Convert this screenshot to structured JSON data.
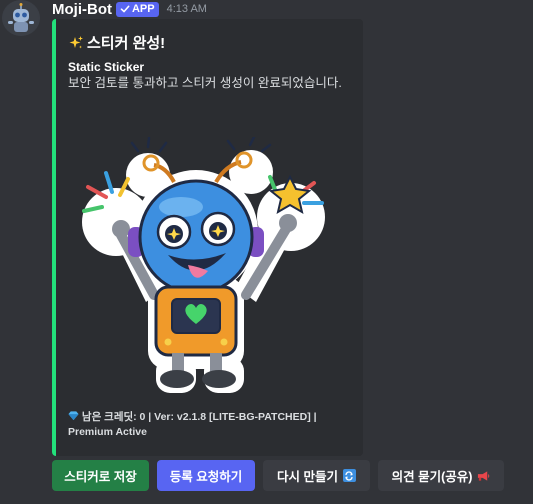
{
  "message": {
    "username": "Moji-Bot",
    "app_badge": "APP",
    "timestamp": "4:13 AM",
    "avatar_icon": "robot-avatar-icon",
    "embed": {
      "accent_color": "#23e07b",
      "title_emoji": "sparkles-icon",
      "title": "스티커 완성!",
      "field_name": "Static Sticker",
      "field_value": "보안 검토를 통과하고 스티커 생성이 완료되었습니다.",
      "image": "robot-sticker-image",
      "footer_emoji": "gem-icon",
      "footer_text": "남은 크레딧: 0 | Ver: v2.1.8 [LITE-BG-PATCHED] | Premium Active"
    },
    "buttons": [
      {
        "label": "스티커로 저장",
        "style": "success",
        "color": "#248046"
      },
      {
        "label": "등록 요청하기",
        "style": "primary",
        "color": "#5865f2"
      },
      {
        "label": "다시 만들기",
        "style": "secondary",
        "emoji": "repeat-icon"
      },
      {
        "label": "의견 묻기(공유)",
        "style": "secondary",
        "emoji": "megaphone-icon"
      }
    ]
  }
}
